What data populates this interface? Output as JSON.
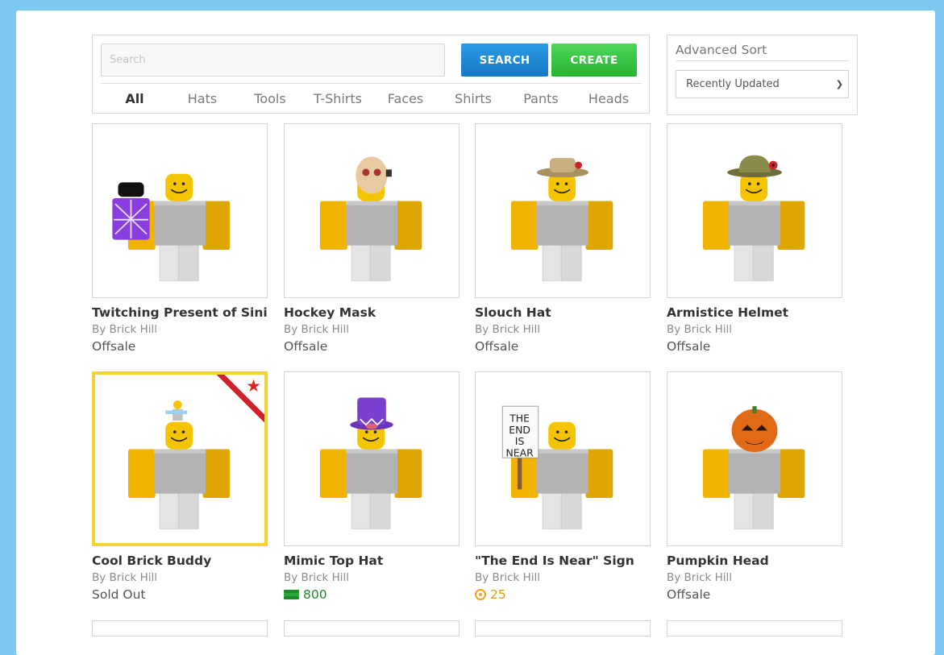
{
  "search": {
    "placeholder": "Search",
    "search_label": "SEARCH",
    "create_label": "CREATE"
  },
  "tabs": [
    {
      "label": "All",
      "active": true
    },
    {
      "label": "Hats"
    },
    {
      "label": "Tools"
    },
    {
      "label": "T-Shirts"
    },
    {
      "label": "Faces"
    },
    {
      "label": "Shirts"
    },
    {
      "label": "Pants"
    },
    {
      "label": "Heads"
    }
  ],
  "sort": {
    "title": "Advanced Sort",
    "selected": "Recently Updated"
  },
  "items": [
    {
      "name": "Twitching Present of Sinis",
      "creator": "By Brick Hill",
      "price": "Offsale",
      "price_type": "text",
      "accessory": "present"
    },
    {
      "name": "Hockey Mask",
      "creator": "By Brick Hill",
      "price": "Offsale",
      "price_type": "text",
      "accessory": "hockey-mask"
    },
    {
      "name": "Slouch Hat",
      "creator": "By Brick Hill",
      "price": "Offsale",
      "price_type": "text",
      "accessory": "slouch-hat"
    },
    {
      "name": "Armistice Helmet",
      "creator": "By Brick Hill",
      "price": "Offsale",
      "price_type": "text",
      "accessory": "helmet"
    },
    {
      "name": "Cool Brick Buddy",
      "creator": "By Brick Hill",
      "price": "Sold Out",
      "price_type": "text",
      "accessory": "buddy",
      "special": true
    },
    {
      "name": "Mimic Top Hat",
      "creator": "By Brick Hill",
      "price": "800",
      "price_type": "bucks",
      "accessory": "top-hat"
    },
    {
      "name": "\"The End Is Near\" Sign",
      "creator": "By Brick Hill",
      "price": "25",
      "price_type": "bits",
      "accessory": "sign",
      "sign_text": [
        "THE",
        "END",
        "IS",
        "NEAR"
      ]
    },
    {
      "name": "Pumpkin Head",
      "creator": "By Brick Hill",
      "price": "Offsale",
      "price_type": "text",
      "accessory": "pumpkin"
    }
  ],
  "colors": {
    "background": "#7ec8f2",
    "search_button": "#1a82d0",
    "create_button": "#2ec53a",
    "special_border": "#f4d13b",
    "bucks": "#1e8a2a",
    "bits": "#e39a12"
  }
}
